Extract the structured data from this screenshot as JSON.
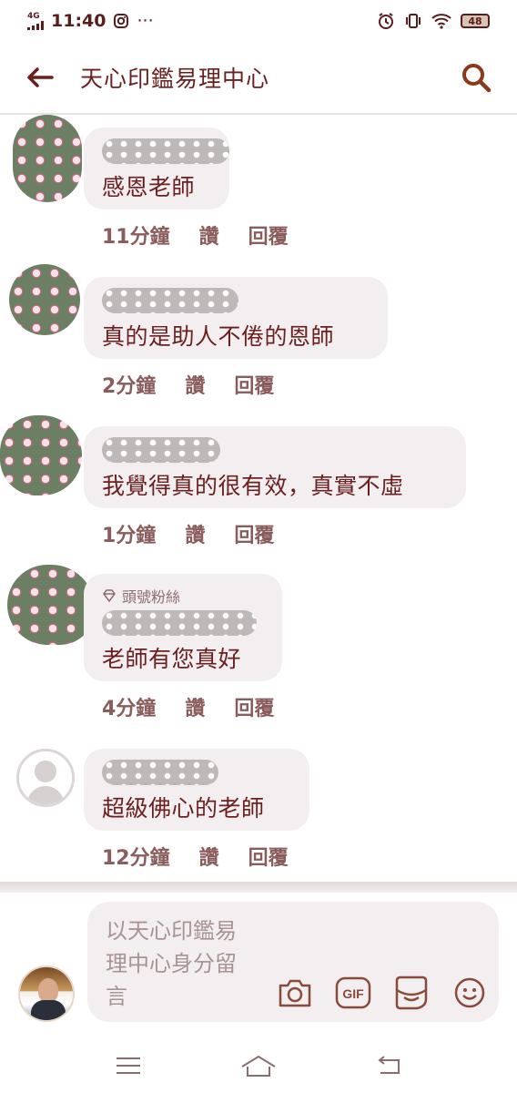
{
  "status_bar": {
    "network": "4G",
    "time": "11:40",
    "extra": "···",
    "battery": "48"
  },
  "header": {
    "title": "天心印鑑易理中心"
  },
  "comments": [
    {
      "text": "感恩老師",
      "time": "11分鐘",
      "like": "讚",
      "reply": "回覆"
    },
    {
      "text": "真的是助人不倦的恩師",
      "time": "2分鐘",
      "like": "讚",
      "reply": "回覆"
    },
    {
      "text": "我覺得真的很有效，真實不虛",
      "time": "1分鐘",
      "like": "讚",
      "reply": "回覆"
    },
    {
      "badge": "頭號粉絲",
      "text": "老師有您真好",
      "time": "4分鐘",
      "like": "讚",
      "reply": "回覆"
    },
    {
      "text": "超級佛心的老師",
      "time": "12分鐘",
      "like": "讚",
      "reply": "回覆"
    }
  ],
  "composer": {
    "placeholder": "以天心印鑑易理中心身分留言",
    "gif_label": "GIF"
  },
  "colors": {
    "accent": "#6b1f1f",
    "bubble": "#f3eef0",
    "meta": "#8a5d5d"
  }
}
